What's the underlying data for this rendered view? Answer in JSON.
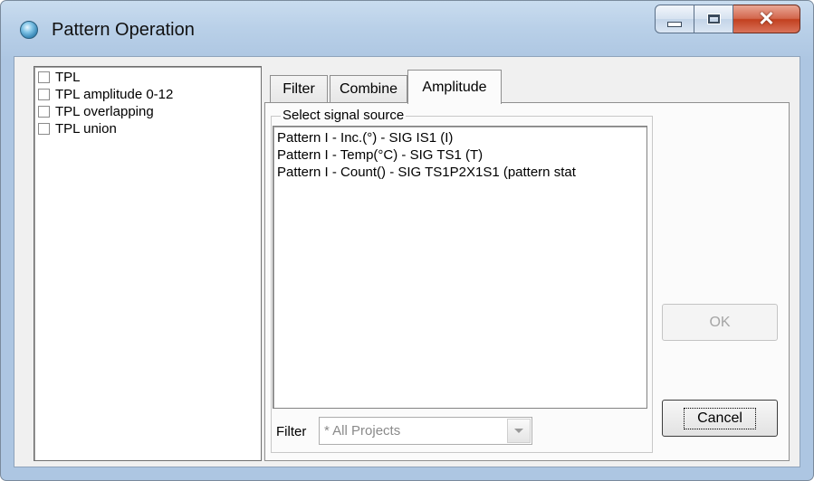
{
  "window": {
    "title": "Pattern Operation",
    "icon": "globe-icon",
    "controls": {
      "minimize": "minimize-icon",
      "maximize": "maximize-icon",
      "close": "close-icon"
    }
  },
  "operations": {
    "items": [
      {
        "label": "TPL",
        "checked": false
      },
      {
        "label": "TPL amplitude 0-12",
        "checked": false
      },
      {
        "label": "TPL overlapping",
        "checked": false
      },
      {
        "label": "TPL union",
        "checked": false
      }
    ]
  },
  "tabs": [
    {
      "label": "Filter",
      "selected": false
    },
    {
      "label": "Combine",
      "selected": false
    },
    {
      "label": "Amplitude",
      "selected": true
    }
  ],
  "amplitude": {
    "group_label": "Select signal source",
    "sources": [
      "Pattern I - Inc.(°) - SIG IS1 (I)",
      "Pattern I - Temp(°C) - SIG TS1 (T)",
      "Pattern I - Count() - SIG TS1P2X1S1 (pattern stat"
    ],
    "filter_label": "Filter",
    "filter_value": "* All Projects"
  },
  "buttons": {
    "ok": "OK",
    "cancel": "Cancel"
  },
  "colors": {
    "titlebar": "#b9d0e8",
    "close_button": "#c9482b",
    "disabled_text": "#a5a5a5"
  }
}
